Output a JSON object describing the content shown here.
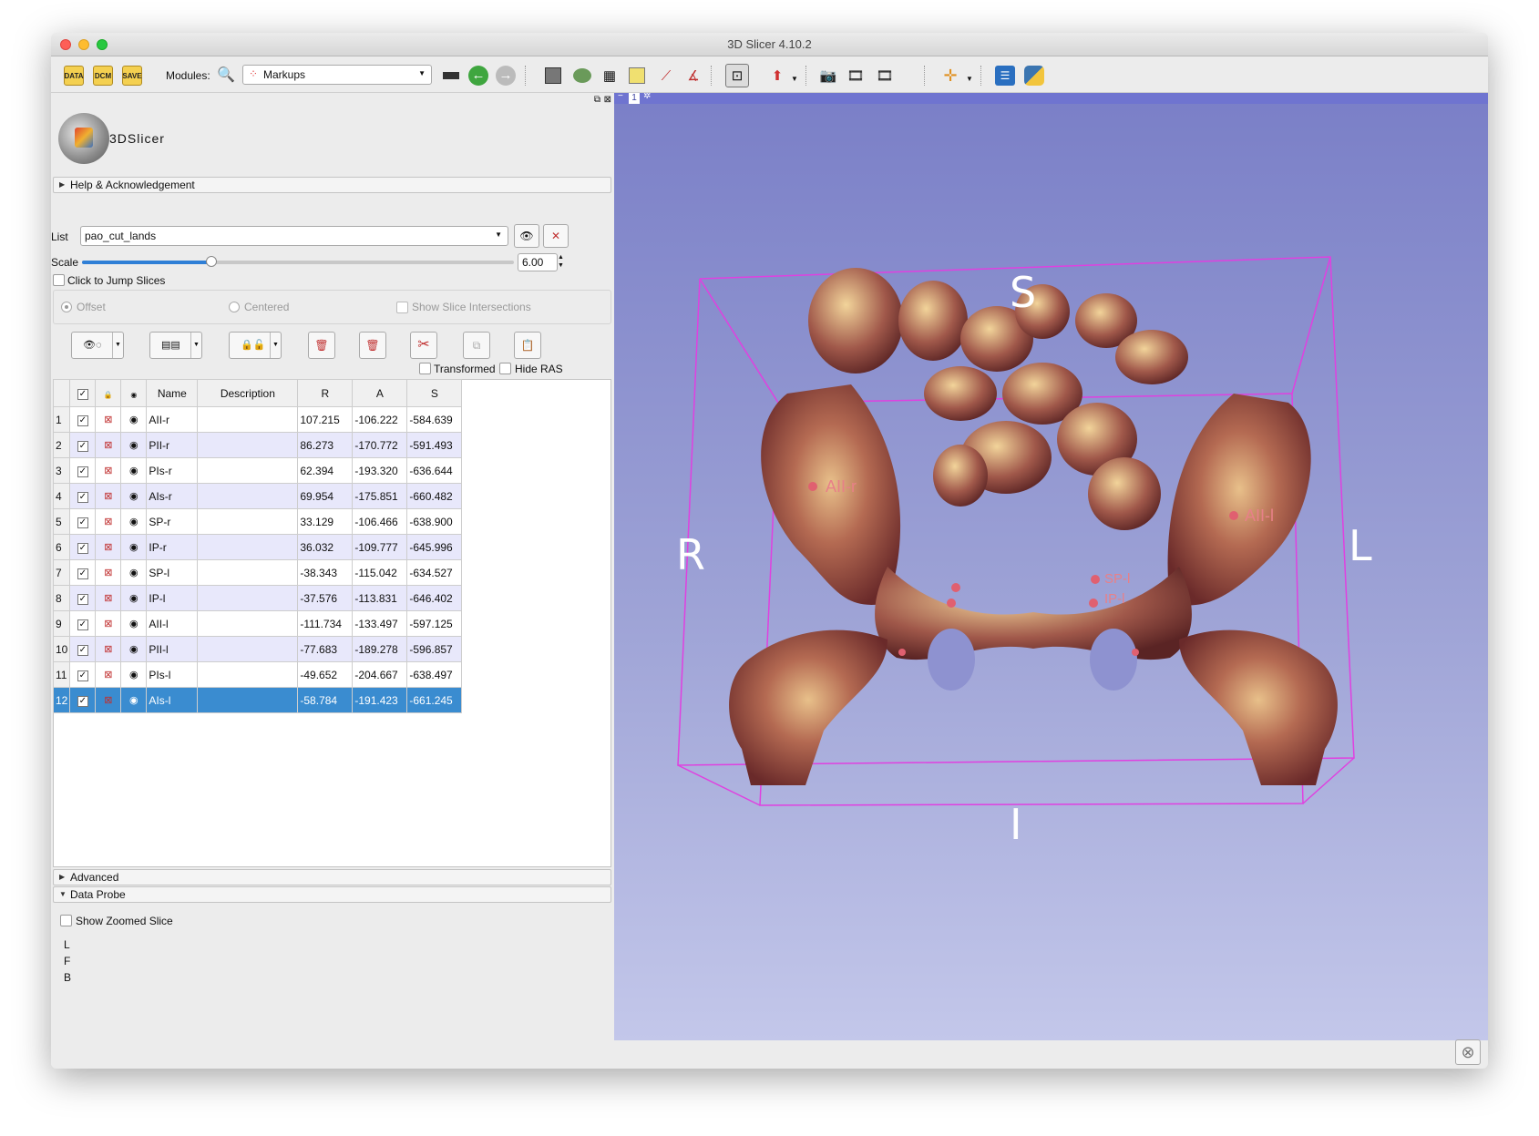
{
  "window": {
    "title": "3D Slicer 4.10.2"
  },
  "toolbar": {
    "data_label": "DATA",
    "dcm_label": "DCM",
    "save_label": "SAVE",
    "modules_label": "Modules:",
    "module_selected": "Markups"
  },
  "logo": {
    "text": "3DSlicer"
  },
  "sections": {
    "help": "Help & Acknowledgement",
    "advanced": "Advanced",
    "data_probe": "Data Probe"
  },
  "list": {
    "label": "List",
    "value": "pao_cut_lands"
  },
  "scale": {
    "label": "Scale",
    "value": "6.00",
    "fraction": 0.3
  },
  "jump": {
    "label": "Click to Jump Slices"
  },
  "jump_modes": {
    "offset": "Offset",
    "centered": "Centered",
    "show_intersections": "Show Slice Intersections"
  },
  "options": {
    "transformed": "Transformed",
    "hide_ras": "Hide RAS"
  },
  "table": {
    "headers": [
      "Name",
      "Description",
      "R",
      "A",
      "S"
    ],
    "rows": [
      {
        "n": "1",
        "name": "AII-r",
        "desc": "",
        "r": "107.215",
        "a": "-106.222",
        "s": "-584.639"
      },
      {
        "n": "2",
        "name": "PII-r",
        "desc": "",
        "r": "86.273",
        "a": "-170.772",
        "s": "-591.493"
      },
      {
        "n": "3",
        "name": "PIs-r",
        "desc": "",
        "r": "62.394",
        "a": "-193.320",
        "s": "-636.644"
      },
      {
        "n": "4",
        "name": "AIs-r",
        "desc": "",
        "r": "69.954",
        "a": "-175.851",
        "s": "-660.482"
      },
      {
        "n": "5",
        "name": "SP-r",
        "desc": "",
        "r": "33.129",
        "a": "-106.466",
        "s": "-638.900"
      },
      {
        "n": "6",
        "name": "IP-r",
        "desc": "",
        "r": "36.032",
        "a": "-109.777",
        "s": "-645.996"
      },
      {
        "n": "7",
        "name": "SP-l",
        "desc": "",
        "r": "-38.343",
        "a": "-115.042",
        "s": "-634.527"
      },
      {
        "n": "8",
        "name": "IP-l",
        "desc": "",
        "r": "-37.576",
        "a": "-113.831",
        "s": "-646.402"
      },
      {
        "n": "9",
        "name": "AII-l",
        "desc": "",
        "r": "-111.734",
        "a": "-133.497",
        "s": "-597.125"
      },
      {
        "n": "10",
        "name": "PII-l",
        "desc": "",
        "r": "-77.683",
        "a": "-189.278",
        "s": "-596.857"
      },
      {
        "n": "11",
        "name": "PIs-l",
        "desc": "",
        "r": "-49.652",
        "a": "-204.667",
        "s": "-638.497"
      },
      {
        "n": "12",
        "name": "AIs-l",
        "desc": "",
        "r": "-58.784",
        "a": "-191.423",
        "s": "-661.245"
      }
    ]
  },
  "probe": {
    "zoom_label": "Show Zoomed Slice",
    "l": "L",
    "f": "F",
    "b": "B"
  },
  "view3d": {
    "view_id": "1",
    "orient": {
      "s": "S",
      "r": "R",
      "l": "L",
      "i": "I"
    },
    "markers": {
      "aii_r": "AII-r",
      "aii_l": "AII-l",
      "sp_l": "SP-l",
      "ip_l": "IP-l"
    },
    "background_colors": [
      "#7a7fc7",
      "#c3c7ea"
    ],
    "box_color": "#e040e0",
    "marker_color": "#e06070"
  }
}
